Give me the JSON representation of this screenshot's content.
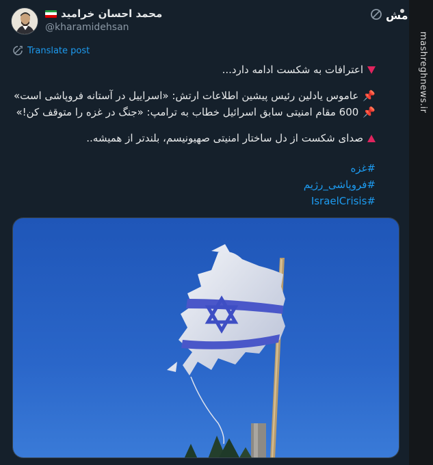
{
  "author": {
    "name": "محمد احسان خرامید",
    "handle": "@kharamidehsan",
    "flag_colors": [
      "#239f40",
      "#ffffff",
      "#da0000"
    ]
  },
  "actions": {
    "translate_label": "Translate post",
    "more_icon": "more-icon",
    "brand_logo": "mashregh-logo"
  },
  "tweet": {
    "line1": "اعترافات به شکست ادامه دارد...",
    "line2": "عاموس یادلین رئیس پیشین اطلاعات ارتش: «اسراییل در آستانه فروپاشی است»",
    "line3": "600 مقام امنیتی سابق اسرائیل خطاب به ترامپ: «جنگ در غزه را متوقف کن!»",
    "line4": "صدای شکست از دل ساختار امنیتی صهیونیسم، بلندتر از همیشه..",
    "bullet_color": "#e0245e"
  },
  "hashtags": [
    "#غزه",
    "#فروپاشی_رژیم",
    "#IsraelCrisis"
  ],
  "media": {
    "description_icon": "torn-israel-flag-image"
  },
  "watermark": {
    "text": "mashreghnews.ir"
  },
  "theme": {
    "background": "#15202b",
    "link": "#1d9bf0",
    "muted": "#8b98a5"
  }
}
